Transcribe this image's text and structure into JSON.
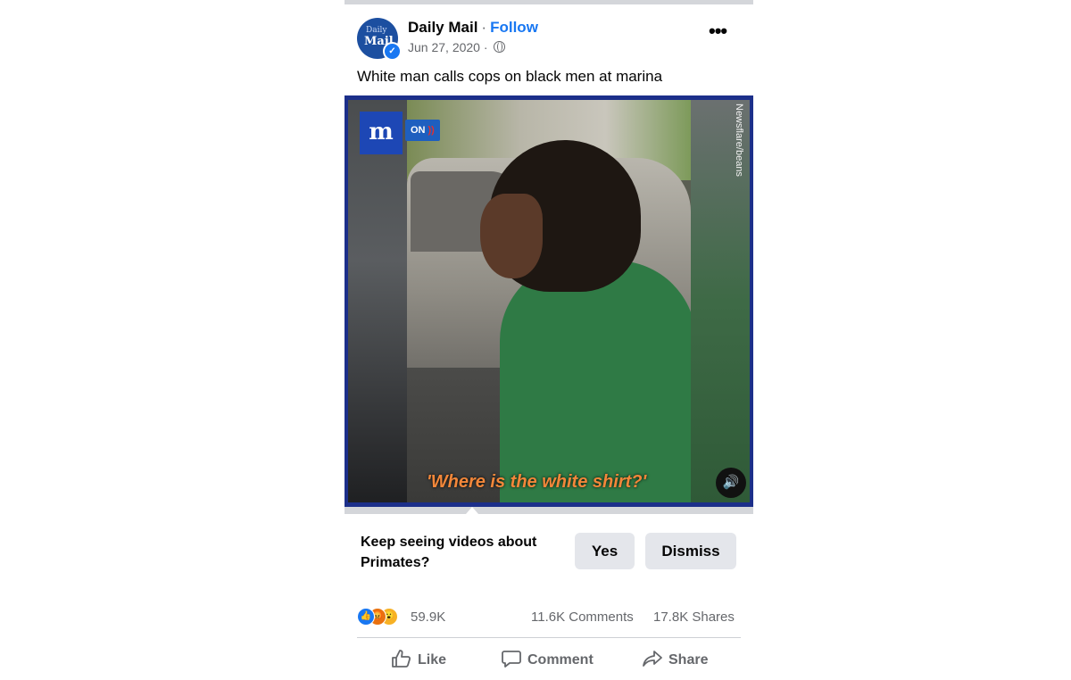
{
  "header": {
    "page_name": "Daily Mail",
    "separator": "·",
    "follow_label": "Follow",
    "date": "Jun 27, 2020 ·",
    "more_label": "•••",
    "avatar_text_top": "Daily",
    "avatar_text_bottom": "Mail"
  },
  "post": {
    "caption": "White man calls cops on black men at marina"
  },
  "video": {
    "brand_logo": "m",
    "sound_badge": "ON",
    "watermark": "Newsflare/beans",
    "subtitle": "'Where is the white shirt?'"
  },
  "feedback": {
    "prompt": "Keep seeing videos about Primates?",
    "yes_label": "Yes",
    "dismiss_label": "Dismiss"
  },
  "stats": {
    "reactions_count": "59.9K",
    "comments": "11.6K Comments",
    "shares": "17.8K Shares",
    "reaction_icons": [
      "like-icon",
      "angry-icon",
      "wow-icon"
    ]
  },
  "actions": {
    "like": "Like",
    "comment": "Comment",
    "share": "Share"
  },
  "colors": {
    "accent": "#1877f2",
    "video_border": "#1c2f8a",
    "subtitle": "#f2873a"
  }
}
